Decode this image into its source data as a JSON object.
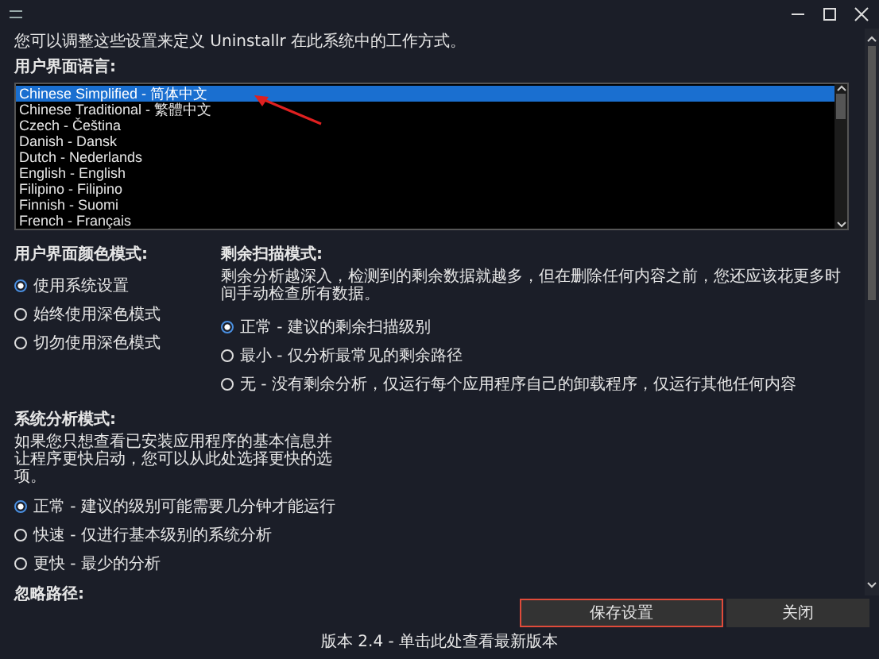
{
  "intro": "您可以调整这些设置来定义 Uninstallr 在此系统中的工作方式。",
  "language": {
    "heading": "用户界面语言:",
    "items": [
      {
        "label": "Chinese Simplified - 简体中文",
        "selected": true
      },
      {
        "label": "Chinese Traditional - 繁體中文",
        "selected": false
      },
      {
        "label": "Czech - Čeština",
        "selected": false
      },
      {
        "label": "Danish - Dansk",
        "selected": false
      },
      {
        "label": "Dutch - Nederlands",
        "selected": false
      },
      {
        "label": "English - English",
        "selected": false
      },
      {
        "label": "Filipino - Filipino",
        "selected": false
      },
      {
        "label": "Finnish - Suomi",
        "selected": false
      },
      {
        "label": "French - Français",
        "selected": false
      }
    ]
  },
  "color_mode": {
    "heading": "用户界面颜色模式:",
    "options": [
      {
        "label": "使用系统设置",
        "selected": true
      },
      {
        "label": "始终使用深色模式",
        "selected": false
      },
      {
        "label": "切勿使用深色模式",
        "selected": false
      }
    ]
  },
  "leftover_scan": {
    "heading": "剩余扫描模式:",
    "description": "剩余分析越深入，检测到的剩余数据就越多，但在删除任何内容之前，您还应该花更多时间手动检查所有数据。",
    "options": [
      {
        "label": "正常 - 建议的剩余扫描级别",
        "selected": true
      },
      {
        "label": "最小 - 仅分析最常见的剩余路径",
        "selected": false
      },
      {
        "label": "无 - 没有剩余分析，仅运行每个应用程序自己的卸载程序，仅运行其他任何内容",
        "selected": false
      }
    ]
  },
  "system_analysis": {
    "heading": "系统分析模式:",
    "description": "如果您只想查看已安装应用程序的基本信息并让程序更快启动，您可以从此处选择更快的选项。",
    "options": [
      {
        "label": "正常 - 建议的级别可能需要几分钟才能运行",
        "selected": true
      },
      {
        "label": "快速 - 仅进行基本级别的系统分析",
        "selected": false
      },
      {
        "label": "更快 - 最少的分析",
        "selected": false
      }
    ]
  },
  "ignore_paths": {
    "heading": "忽略路径:"
  },
  "buttons": [
    {
      "label": "保存设置",
      "highlighted": true
    },
    {
      "label": "关闭",
      "highlighted": false
    }
  ],
  "footer": "版本 2.4 - 单击此处查看最新版本"
}
